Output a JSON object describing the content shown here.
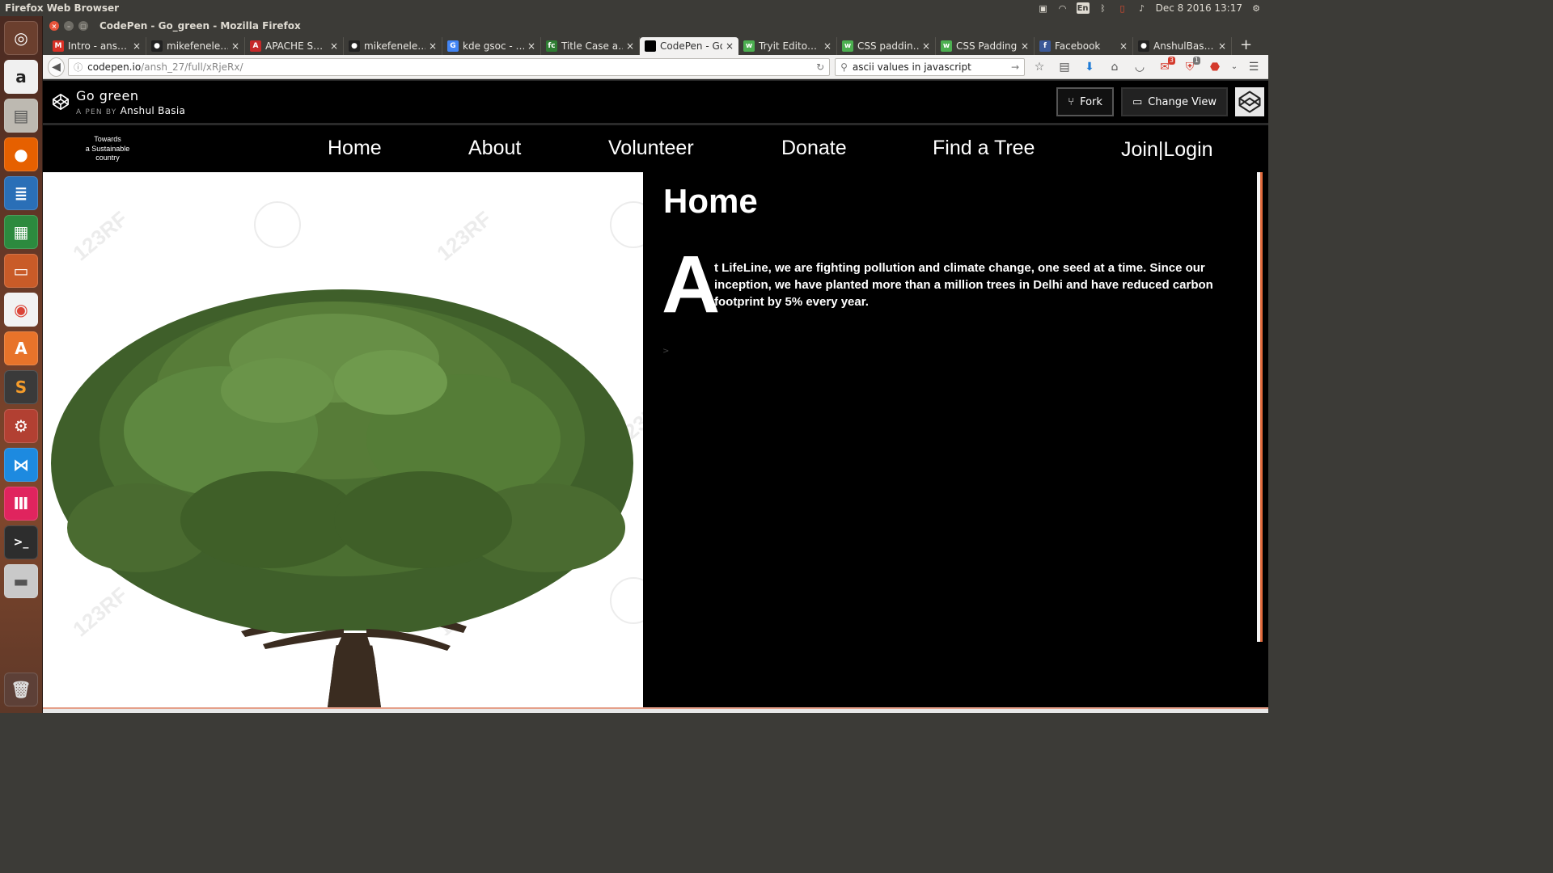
{
  "top_panel": {
    "app_name": "Firefox Web Browser",
    "keyboard_layout": "En",
    "clock": "Dec 8 2016 13:17"
  },
  "launcher": {
    "items": [
      "ubuntu-dash",
      "amazon",
      "files",
      "firefox",
      "libreoffice-writer",
      "libreoffice-calc",
      "libreoffice-impress",
      "chrome",
      "software-center",
      "sublime-text",
      "system-settings",
      "vscode",
      "gitkraken",
      "terminal",
      "disks",
      "trash"
    ]
  },
  "window": {
    "title": "CodePen - Go_green - Mozilla Firefox"
  },
  "tabs": [
    {
      "label": "Intro - ans…",
      "icon_color": "#d93025",
      "icon": "M"
    },
    {
      "label": "mikefenele…",
      "icon_color": "#222222",
      "icon": "●"
    },
    {
      "label": "APACHE S…",
      "icon_color": "#c62828",
      "icon": "A"
    },
    {
      "label": "mikefenele…",
      "icon_color": "#222222",
      "icon": "●"
    },
    {
      "label": "kde gsoc - …",
      "icon_color": "#4285f4",
      "icon": "G"
    },
    {
      "label": "Title Case a…",
      "icon_color": "#2e7d32",
      "icon": "fc"
    },
    {
      "label": "CodePen - Go_…",
      "icon_color": "#000000",
      "icon": "",
      "active": true
    },
    {
      "label": "Tryit Edito…",
      "icon_color": "#4caf50",
      "icon": "w"
    },
    {
      "label": "CSS paddin…",
      "icon_color": "#4caf50",
      "icon": "w"
    },
    {
      "label": "CSS Padding",
      "icon_color": "#4caf50",
      "icon": "w"
    },
    {
      "label": "Facebook",
      "icon_color": "#3b5998",
      "icon": "f"
    },
    {
      "label": "AnshulBas…",
      "icon_color": "#222222",
      "icon": "●"
    }
  ],
  "navbar": {
    "url_host": "codepen.io",
    "url_path": "/ansh_27/full/xRjeRx/",
    "search_value": "ascii values in javascript",
    "gmail_badge": "3",
    "ublock_badge": "1"
  },
  "codepen": {
    "pen_name": "Go  green",
    "byline": "A PEN BY",
    "author": "Anshul Basia",
    "fork_label": "Fork",
    "change_view_label": "Change View"
  },
  "pen": {
    "tagline_line1": "Towards",
    "tagline_line2": "a Sustainable",
    "tagline_line3": "country",
    "nav": [
      "Home",
      "About",
      "Volunteer",
      "Donate",
      "Find a Tree",
      "Join|Login"
    ],
    "heading": "Home",
    "dropcap": "A",
    "intro": "t LifeLine, we are fighting pollution and climate change, one seed at a time. Since our inception, we have planted more than a million trees in Delhi and have reduced carbon footprint by 5% every year.",
    "caret": ">",
    "watermark": "123RF"
  },
  "colors": {
    "launcher_accent": "#80472c",
    "scrollbar_accent": "#e06a3c"
  }
}
